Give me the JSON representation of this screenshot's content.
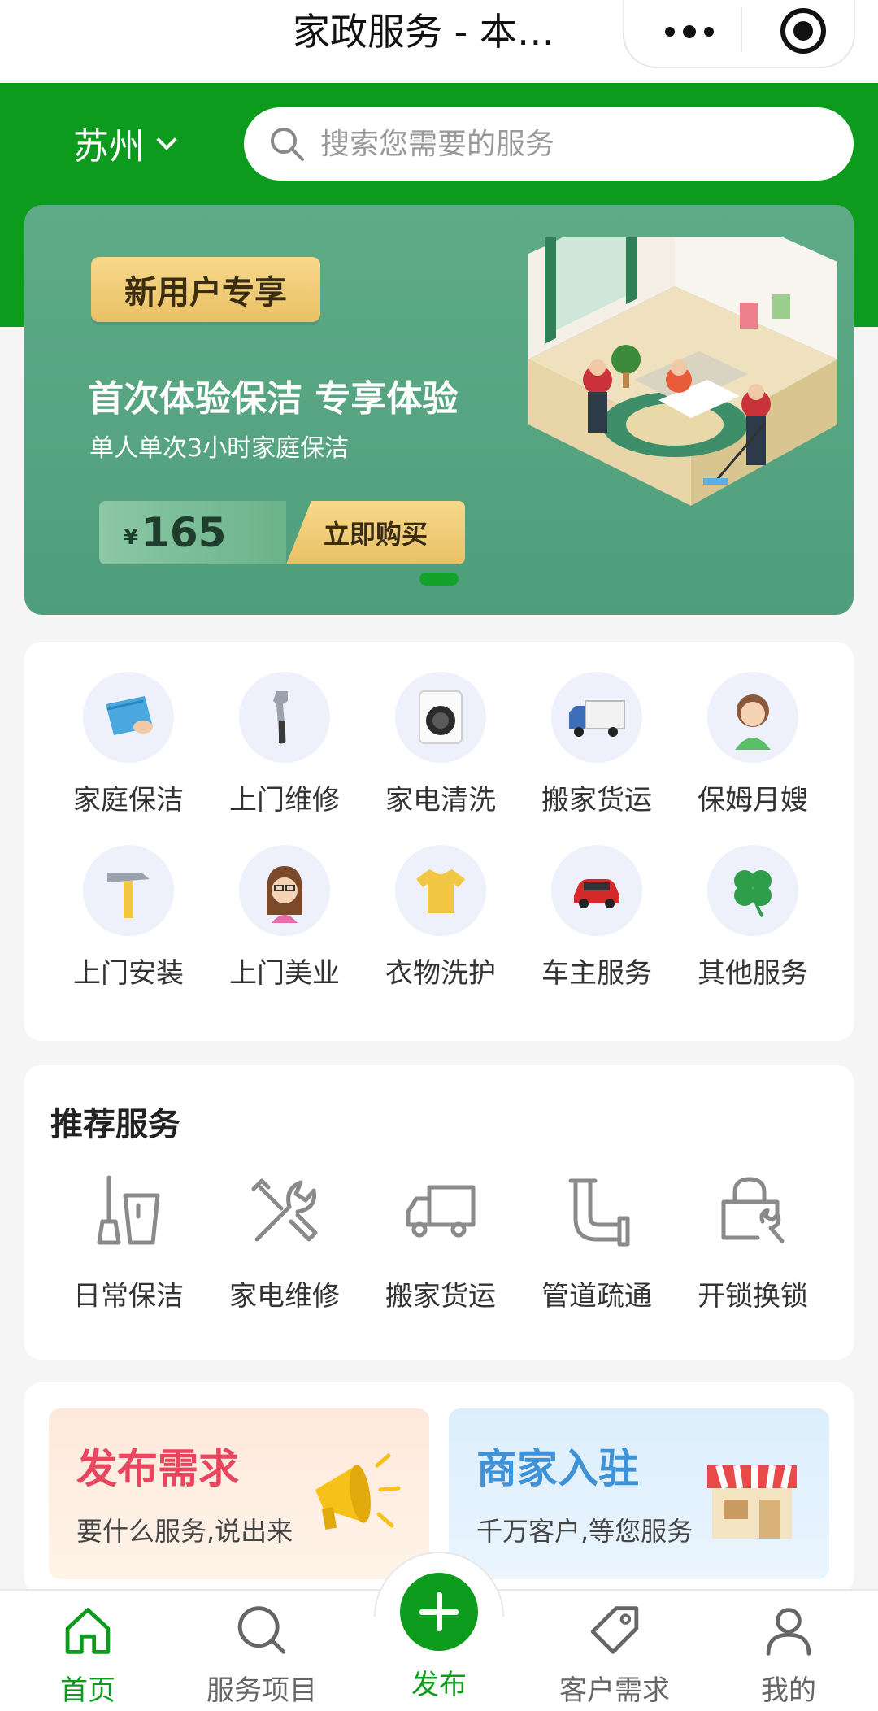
{
  "titlebar": {
    "title": "家政服务 - 本…"
  },
  "header": {
    "city": "苏州",
    "search_placeholder": "搜索您需要的服务"
  },
  "banner": {
    "badge": "新用户专享",
    "headline": "首次体验保洁 专享体验",
    "subline": "单人单次3小时家庭保洁",
    "currency": "¥",
    "price": "165",
    "buy_label": "立即购买"
  },
  "categories": [
    {
      "label": "家庭保洁",
      "icon": "cleaning-cloth-icon"
    },
    {
      "label": "上门维修",
      "icon": "wrench-icon"
    },
    {
      "label": "家电清洗",
      "icon": "washing-machine-icon"
    },
    {
      "label": "搬家货运",
      "icon": "truck-icon"
    },
    {
      "label": "保姆月嫂",
      "icon": "nanny-icon"
    },
    {
      "label": "上门安装",
      "icon": "hammer-icon"
    },
    {
      "label": "上门美业",
      "icon": "beauty-icon"
    },
    {
      "label": "衣物洗护",
      "icon": "tshirt-icon"
    },
    {
      "label": "车主服务",
      "icon": "car-icon"
    },
    {
      "label": "其他服务",
      "icon": "clover-icon"
    }
  ],
  "recommend": {
    "title": "推荐服务",
    "items": [
      {
        "label": "日常保洁",
        "icon": "broom-bucket-icon"
      },
      {
        "label": "家电维修",
        "icon": "tools-icon"
      },
      {
        "label": "搬家货运",
        "icon": "delivery-truck-icon"
      },
      {
        "label": "管道疏通",
        "icon": "pipe-icon"
      },
      {
        "label": "开锁换锁",
        "icon": "lock-wrench-icon"
      }
    ]
  },
  "promos": {
    "publish": {
      "title": "发布需求",
      "subtitle": "要什么服务,说出来"
    },
    "merchant": {
      "title": "商家入驻",
      "subtitle": "千万客户,等您服务"
    }
  },
  "tabbar": {
    "home": "首页",
    "services": "服务项目",
    "publish": "发布",
    "needs": "客户需求",
    "mine": "我的"
  },
  "colors": {
    "brand_green": "#0c9b1d",
    "banner_green": "#5fab88",
    "gold": "#e9c066",
    "publish_red": "#e8455f",
    "merchant_blue": "#3f92d6"
  }
}
